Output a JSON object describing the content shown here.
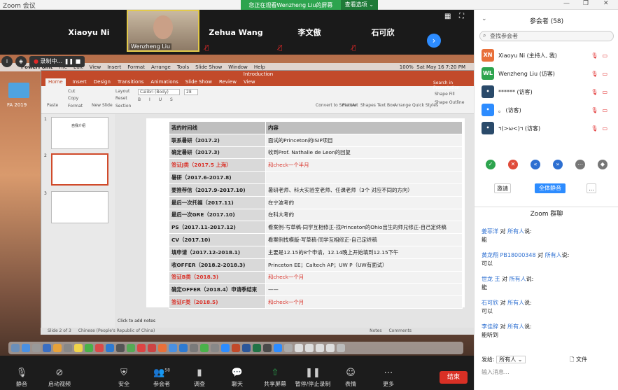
{
  "app": {
    "title": "Zoom 会议",
    "banner": "您正在观看Wenzheng Liu的屏幕",
    "view_options": "查看选项"
  },
  "videos": [
    {
      "name": "Xiaoyu Ni"
    },
    {
      "name": "Wenzheng Liu"
    },
    {
      "name": "Zehua Wang"
    },
    {
      "name": "李文傲"
    },
    {
      "name": "石可欣"
    }
  ],
  "recording": {
    "label": "录制中..."
  },
  "mac": {
    "menu": [
      "PowerPoint",
      "File",
      "Edit",
      "View",
      "Insert",
      "Format",
      "Arrange",
      "Tools",
      "Slide Show",
      "Window",
      "Help"
    ],
    "clock": "Sat May 16  7:20 PM",
    "battery": "100%",
    "desktop_folder": "FA 2019"
  },
  "ppt": {
    "title": "Introduction",
    "tabs": [
      "Home",
      "Insert",
      "Design",
      "Transitions",
      "Animations",
      "Slide Show",
      "Review",
      "View"
    ],
    "ribbon": {
      "paste": "Paste",
      "cut": "Cut",
      "copy": "Copy",
      "format": "Format",
      "new_slide": "New Slide",
      "layout": "Layout",
      "reset": "Reset",
      "section": "Section",
      "font": "Calibri (Body)",
      "size": "28",
      "convert": "Convert to SmartArt",
      "picture": "Picture",
      "shapes": "Shapes",
      "textbox": "Text Box",
      "arrange": "Arrange",
      "quick_styles": "Quick Styles",
      "shape_fill": "Shape Fill",
      "shape_outline": "Shape Outline",
      "search": "Search in Presentation"
    },
    "thumb1_title": "自我介绍",
    "table": {
      "header": [
        "我的时间线",
        "内容"
      ],
      "rows": [
        [
          "联系暑研（2017.2)",
          "面试的Princeton的ISIP项目",
          false
        ],
        [
          "确定暑研（2017.3)",
          "收到Prof. Nathalie de Leon的回复",
          false
        ],
        [
          "签证J类（2017.5 上海）",
          "和check一个半月",
          true
        ],
        [
          "暑研（2017.6-2017.8)",
          "",
          false
        ],
        [
          "要推荐信（2017.9-2017.10)",
          "暑研老师、科大实验室老师、任课老师（3个 对应不同的方向）",
          false
        ],
        [
          "最后一次托福（2017.11)",
          "在宁波考的",
          false
        ],
        [
          "最后一次GRE（2017.10)",
          "在科大考的",
          false
        ],
        [
          "PS（2017.11-2017.12)",
          "看案例-写草稿-同学互相修正-找Princeton的Ohio出生的师兄修正-自己定终稿",
          false
        ],
        [
          "CV（2017.10)",
          "看案例找模版-写草稿-同学互相修正-自己定终稿",
          false
        ],
        [
          "填申请（2017.12-2018.1)",
          "主要是12.15的8个申请，12.14晚上开始填到12.15下午",
          false
        ],
        [
          "收OFFER（2018.2-2018.3)",
          "Princeton EE；Caltech AP；UW P（UW有面试）",
          false
        ],
        [
          "签证B类（2018.3)",
          "和check一个月",
          true
        ],
        [
          "确定OFFER（2018.4）申请季结束",
          "——",
          false
        ],
        [
          "签证F类（2018.5)",
          "和check一个月",
          true
        ]
      ]
    },
    "notes": "Click to add notes",
    "status": {
      "slide": "Slide 2 of 3",
      "lang": "Chinese (People's Republic of China)",
      "notes_btn": "Notes",
      "comments_btn": "Comments"
    }
  },
  "toolbar": [
    {
      "label": "静音",
      "icon": "mic-icon"
    },
    {
      "label": "启动视频",
      "icon": "video-off-icon"
    },
    {
      "label": "安全",
      "icon": "shield-icon"
    },
    {
      "label": "参会者",
      "icon": "participants-icon",
      "badge": "58"
    },
    {
      "label": "调查",
      "icon": "poll-icon"
    },
    {
      "label": "聊天",
      "icon": "chat-icon"
    },
    {
      "label": "共享屏幕",
      "icon": "share-icon"
    },
    {
      "label": "暂停/停止录制",
      "icon": "pause-icon"
    },
    {
      "label": "表情",
      "icon": "emoji-icon"
    },
    {
      "label": "更多",
      "icon": "more-icon"
    }
  ],
  "end_label": "结束",
  "panel": {
    "participants_title": "参会者 (58)",
    "search_placeholder": "查找参会者",
    "participants": [
      {
        "initials": "XN",
        "name": "Xiaoyu Ni (主持人, 我)",
        "color": "#e8703a"
      },
      {
        "initials": "WL",
        "name": "Wenzheng Liu (访客)",
        "color": "#2da44e"
      },
      {
        "initials": "•",
        "name": "****** (访客)",
        "color": "#2a4a6a"
      },
      {
        "initials": "•",
        "name": "。 (访客)",
        "color": "#2d8cff"
      },
      {
        "initials": "•",
        "name": "ฯ(>ω<)ฯ (访客)",
        "color": "#2a4a6a"
      }
    ],
    "invite": "邀请",
    "mute_all": "全体静音",
    "more": "...",
    "chat_title": "Zoom 群聊",
    "chats": [
      {
        "from": "姜菲洋",
        "to": "所有人",
        "msg": "能"
      },
      {
        "from": "黄龙翔 PB18000348",
        "to": "所有人",
        "msg": "可以"
      },
      {
        "from": "世龙 王",
        "to": "所有人",
        "msg": "能"
      },
      {
        "from": "石可欣",
        "to": "所有人",
        "msg": "可以"
      },
      {
        "from": "李佳辞",
        "to": "所有人",
        "msg": "能听到"
      }
    ],
    "to_label": "对",
    "said": "说:",
    "send_to": "发给:",
    "send_to_val": "所有人",
    "file": "文件",
    "input_placeholder": "输入消息..."
  }
}
